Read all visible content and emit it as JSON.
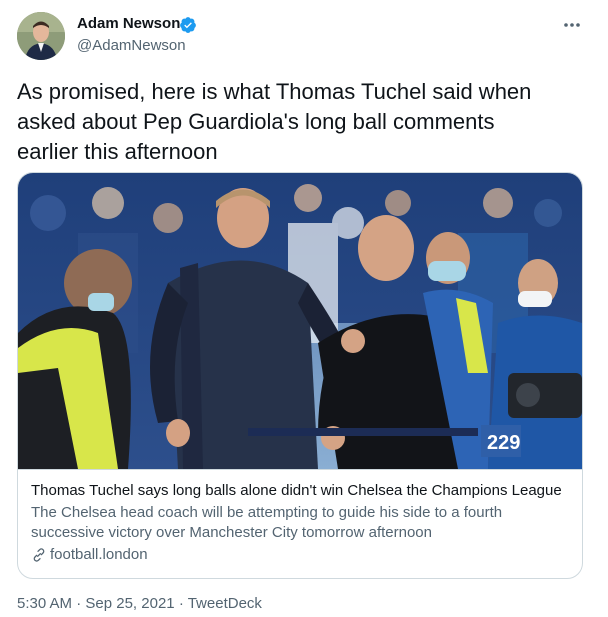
{
  "author": {
    "display_name": "Adam Newson",
    "handle": "@AdamNewson",
    "verified": true,
    "verified_color": "#1d9bf0"
  },
  "tweet": {
    "text_lines": [
      "As promised, here is what Thomas Tuchel said when",
      "asked about Pep Guardiola's long ball comments",
      "earlier this afternoon"
    ]
  },
  "card": {
    "image_icon": "photo-of-two-football-managers",
    "title": "Thomas Tuchel says long balls alone didn't win Chelsea the Champions League",
    "description_lines": [
      "The Chelsea head coach will be attempting to guide his side to a fourth",
      "successive victory over Manchester City tomorrow afternoon"
    ],
    "domain": "football.london",
    "stand_sign": "229"
  },
  "meta": {
    "time": "5:30 AM",
    "separator": "·",
    "date": "Sep 25, 2021",
    "source": "TweetDeck"
  },
  "colors": {
    "text_primary": "#0f1419",
    "text_secondary": "#536471",
    "border": "#cfd9de"
  },
  "icons": {
    "more": "more-horizontal-icon",
    "verified": "verified-badge-icon",
    "link": "link-icon"
  }
}
